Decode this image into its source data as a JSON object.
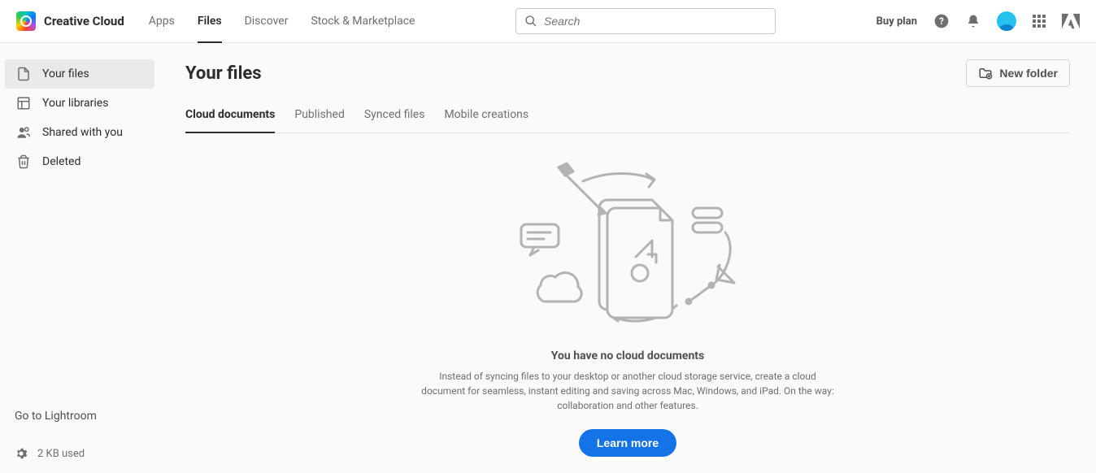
{
  "brand": "Creative Cloud",
  "topnav": [
    "Apps",
    "Files",
    "Discover",
    "Stock & Marketplace"
  ],
  "topnav_active": 1,
  "search": {
    "placeholder": "Search"
  },
  "header_right": {
    "buy_plan": "Buy plan"
  },
  "sidebar": {
    "items": [
      {
        "label": "Your files"
      },
      {
        "label": "Your libraries"
      },
      {
        "label": "Shared with you"
      },
      {
        "label": "Deleted"
      }
    ],
    "active_index": 0,
    "lightroom_link": "Go to Lightroom",
    "storage_used": "2 KB used"
  },
  "main": {
    "title": "Your files",
    "new_folder_label": "New folder",
    "tabs": [
      "Cloud documents",
      "Published",
      "Synced files",
      "Mobile creations"
    ],
    "tabs_active": 0,
    "empty": {
      "title": "You have no cloud documents",
      "desc": "Instead of syncing files to your desktop or another cloud storage service, create a cloud document for seamless, instant editing and saving across Mac, Windows, and iPad. On the way: collaboration and other features.",
      "learn_label": "Learn more"
    }
  }
}
